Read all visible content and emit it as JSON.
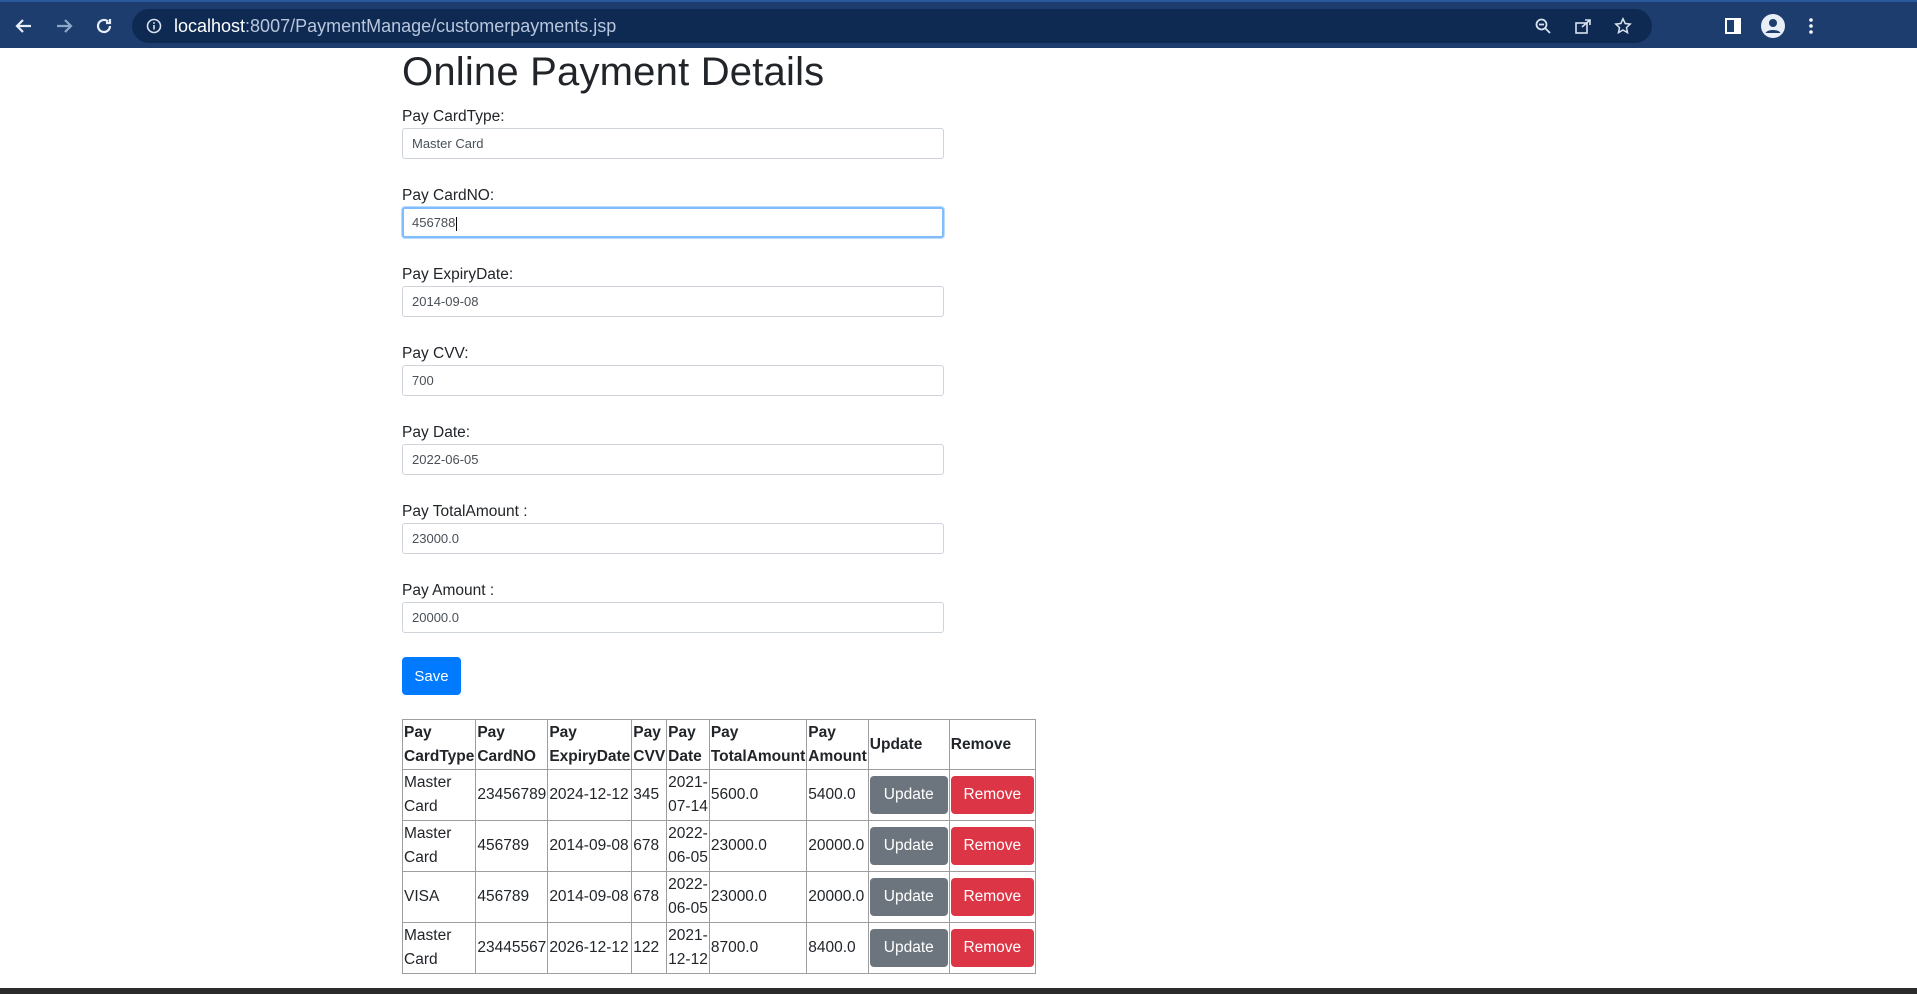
{
  "browser": {
    "url_host": "localhost",
    "url_path": ":8007/PaymentManage/customerpayments.jsp"
  },
  "page": {
    "title": "Online Payment Details"
  },
  "form": {
    "card_type": {
      "label": "Pay CardType:",
      "value": "Master Card"
    },
    "card_no": {
      "label": "Pay CardNO:",
      "value": "456788"
    },
    "expiry_date": {
      "label": "Pay ExpiryDate:",
      "value": "2014-09-08"
    },
    "cvv": {
      "label": "Pay CVV:",
      "value": "700"
    },
    "pay_date": {
      "label": "Pay Date:",
      "value": "2022-06-05"
    },
    "total_amount": {
      "label": "Pay TotalAmount :",
      "value": "23000.0"
    },
    "amount": {
      "label": "Pay Amount :",
      "value": "20000.0"
    },
    "save_label": "Save"
  },
  "table": {
    "headers": [
      [
        "Pay",
        "CardType"
      ],
      [
        "Pay",
        "CardNO"
      ],
      [
        "Pay",
        "ExpiryDate"
      ],
      [
        "Pay",
        "CVV"
      ],
      [
        "Pay",
        "Date"
      ],
      [
        "Pay",
        "TotalAmount"
      ],
      [
        "Pay",
        "Amount"
      ],
      [
        "Update",
        ""
      ],
      [
        "Remove",
        ""
      ]
    ],
    "update_label": "Update",
    "remove_label": "Remove",
    "rows": [
      {
        "card_type": [
          "Master",
          "Card"
        ],
        "card_no": "23456789",
        "expiry": "2024-12-12",
        "cvv": "345",
        "date": [
          "2021-",
          "07-14"
        ],
        "total": "5600.0",
        "amount": "5400.0"
      },
      {
        "card_type": [
          "Master",
          "Card"
        ],
        "card_no": "456789",
        "expiry": "2014-09-08",
        "cvv": "678",
        "date": [
          "2022-",
          "06-05"
        ],
        "total": "23000.0",
        "amount": "20000.0"
      },
      {
        "card_type": [
          "VISA",
          ""
        ],
        "card_no": "456789",
        "expiry": "2014-09-08",
        "cvv": "678",
        "date": [
          "2022-",
          "06-05"
        ],
        "total": "23000.0",
        "amount": "20000.0"
      },
      {
        "card_type": [
          "Master",
          "Card"
        ],
        "card_no": "23445567",
        "expiry": "2026-12-12",
        "cvv": "122",
        "date": [
          "2021-",
          "12-12"
        ],
        "total": "8700.0",
        "amount": "8400.0"
      }
    ]
  },
  "colors": {
    "primary": "#007bff",
    "secondary": "#6c757d",
    "danger": "#dc3545",
    "chrome": "#1c3d6e"
  }
}
